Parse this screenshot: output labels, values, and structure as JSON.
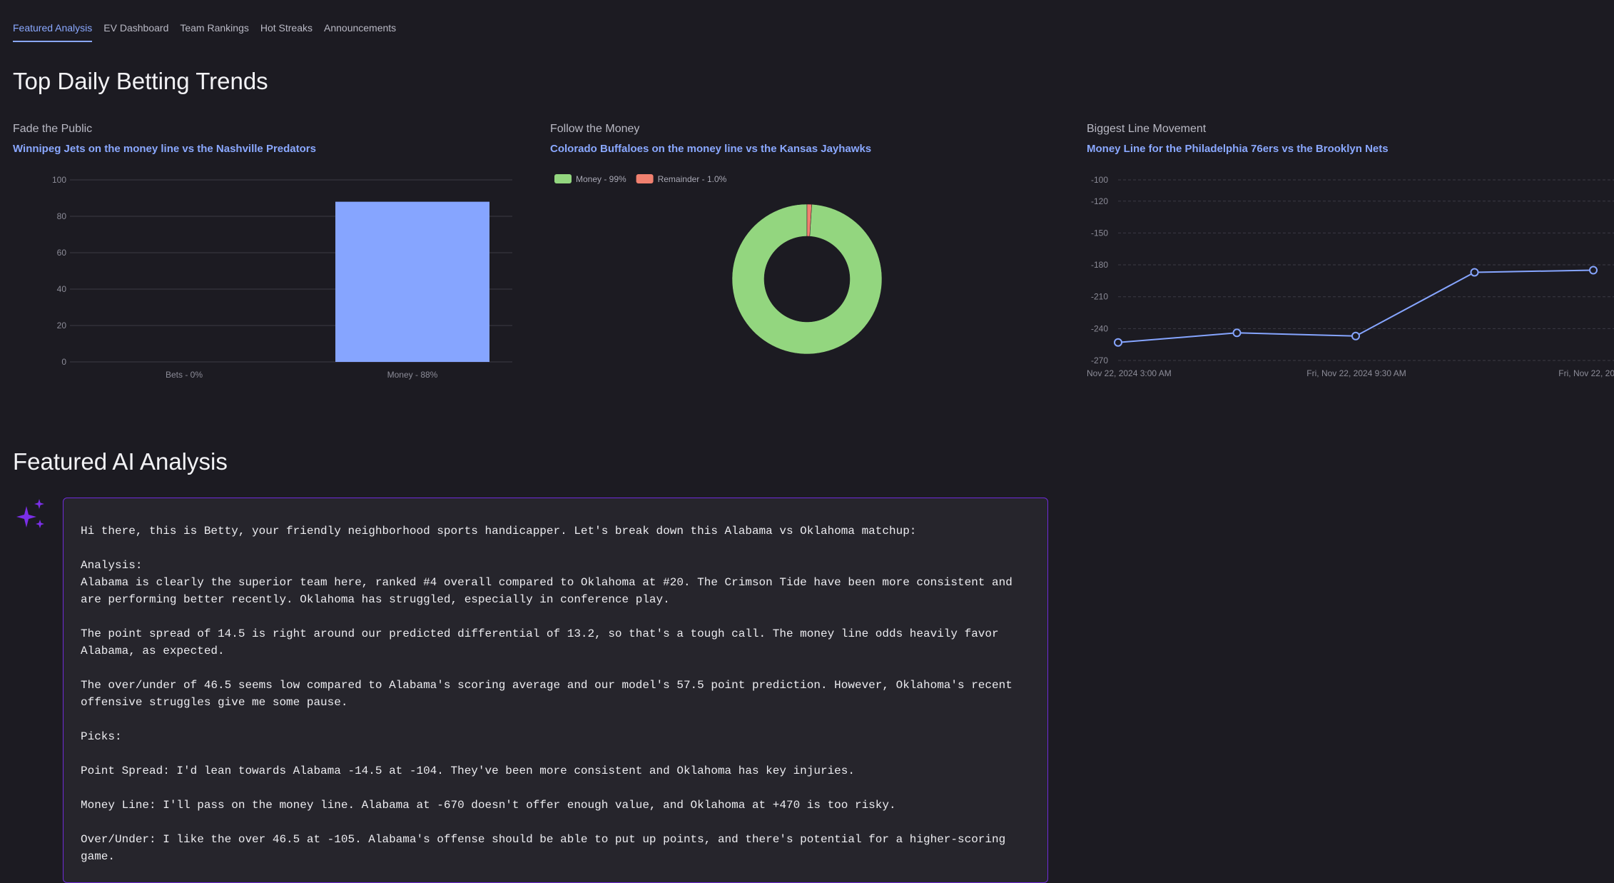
{
  "tabs": [
    {
      "label": "Featured Analysis",
      "active": true
    },
    {
      "label": "EV Dashboard"
    },
    {
      "label": "Team Rankings"
    },
    {
      "label": "Hot Streaks"
    },
    {
      "label": "Announcements"
    }
  ],
  "trends": {
    "title": "Top Daily Betting Trends",
    "cards": [
      {
        "kicker": "Fade the Public",
        "headline": "Winnipeg Jets on the money line vs the Nashville Predators"
      },
      {
        "kicker": "Follow the Money",
        "headline": "Colorado Buffaloes on the money line vs the Kansas Jayhawks"
      },
      {
        "kicker": "Biggest Line Movement",
        "headline": "Money Line for the Philadelphia 76ers vs the Brooklyn Nets"
      }
    ]
  },
  "colors": {
    "accent": "#8aa8ff",
    "money_green": "#93d67f",
    "remainder_red": "#f0806f",
    "ai_border": "#6f2bd9"
  },
  "chart_data": [
    {
      "type": "bar",
      "categories": [
        "Bets - 0%",
        "Money - 88%"
      ],
      "values": [
        0,
        88
      ],
      "ylim": [
        0,
        100
      ],
      "yticks": [
        0,
        20,
        40,
        60,
        80,
        100
      ],
      "grid": true
    },
    {
      "type": "pie",
      "labels": [
        "Money - 99%",
        "Remainder - 1.0%"
      ],
      "values": [
        99,
        1
      ],
      "colors": [
        "#93d67f",
        "#f0806f"
      ],
      "legend": "top-left",
      "donut": true
    },
    {
      "type": "line",
      "x": [
        0,
        1,
        2,
        3,
        4
      ],
      "values": [
        -253,
        -244,
        -247,
        -187,
        -185
      ],
      "ylim": [
        -270,
        -100
      ],
      "yticks": [
        "-100",
        "-120",
        "-150",
        "-180",
        "-210",
        "-240",
        "-270"
      ],
      "xtick_labels": [
        "Nov 22, 2024 3:00 AM",
        "Fri, Nov 22, 2024 9:30 AM",
        "Fri, Nov 22, 20"
      ],
      "grid": "dashed"
    }
  ],
  "ai": {
    "title": "Featured AI Analysis",
    "icon": "sparkles-icon",
    "text": "Hi there, this is Betty, your friendly neighborhood sports handicapper. Let's break down this Alabama vs Oklahoma matchup:\n\nAnalysis:\nAlabama is clearly the superior team here, ranked #4 overall compared to Oklahoma at #20. The Crimson Tide have been more consistent and are performing better recently. Oklahoma has struggled, especially in conference play.\n\nThe point spread of 14.5 is right around our predicted differential of 13.2, so that's a tough call. The money line odds heavily favor Alabama, as expected.\n\nThe over/under of 46.5 seems low compared to Alabama's scoring average and our model's 57.5 point prediction. However, Oklahoma's recent offensive struggles give me some pause.\n\nPicks:\n\nPoint Spread: I'd lean towards Alabama -14.5 at -104. They've been more consistent and Oklahoma has key injuries.\n\nMoney Line: I'll pass on the money line. Alabama at -670 doesn't offer enough value, and Oklahoma at +470 is too risky.\n\nOver/Under: I like the over 46.5 at -105. Alabama's offense should be able to put up points, and there's potential for a higher-scoring game."
  }
}
